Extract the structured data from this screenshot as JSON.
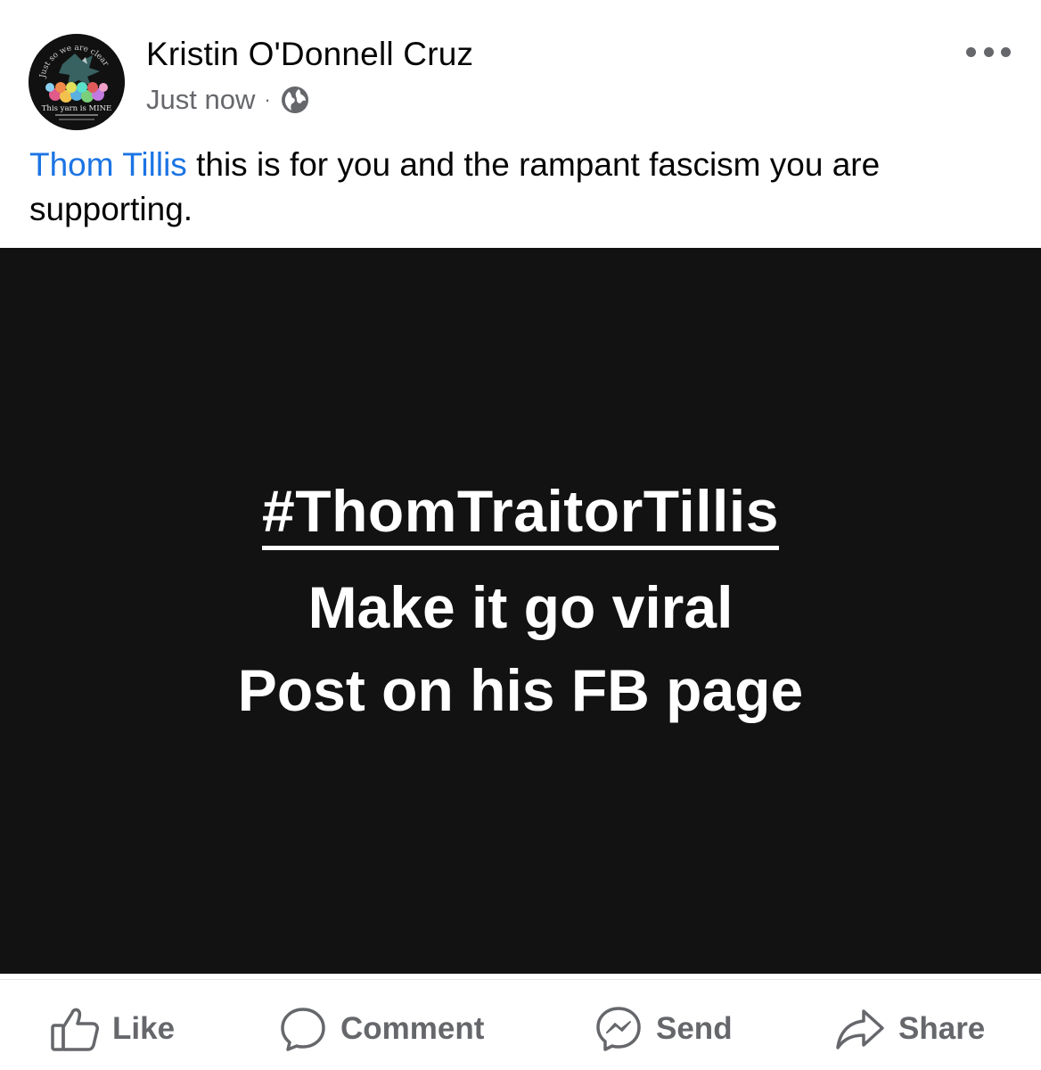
{
  "post": {
    "author": {
      "name": "Kristin O'Donnell Cruz",
      "avatar_icon": "yarn-dragon-avatar",
      "avatar_texts": {
        "top": "Just so we are clear",
        "bottom": "This yarn is MINE"
      }
    },
    "timestamp": "Just now",
    "separator": "·",
    "privacy_icon": "globe-icon",
    "menu_icon": "more-options-icon",
    "text": {
      "mention": "Thom Tillis",
      "body": " this is for you and the rampant fascism you are supporting."
    },
    "image": {
      "hashtag": "#ThomTraitorTillis",
      "line2": "Make it go viral",
      "line3": "Post on his FB page",
      "background_color": "#121212"
    }
  },
  "actions": {
    "like": {
      "label": "Like",
      "icon": "thumbs-up-icon"
    },
    "comment": {
      "label": "Comment",
      "icon": "comment-bubble-icon"
    },
    "send": {
      "label": "Send",
      "icon": "messenger-icon"
    },
    "share": {
      "label": "Share",
      "icon": "share-arrow-icon"
    }
  },
  "colors": {
    "mention": "#1b74e4",
    "secondary_text": "#65676b",
    "primary_text": "#050505"
  }
}
